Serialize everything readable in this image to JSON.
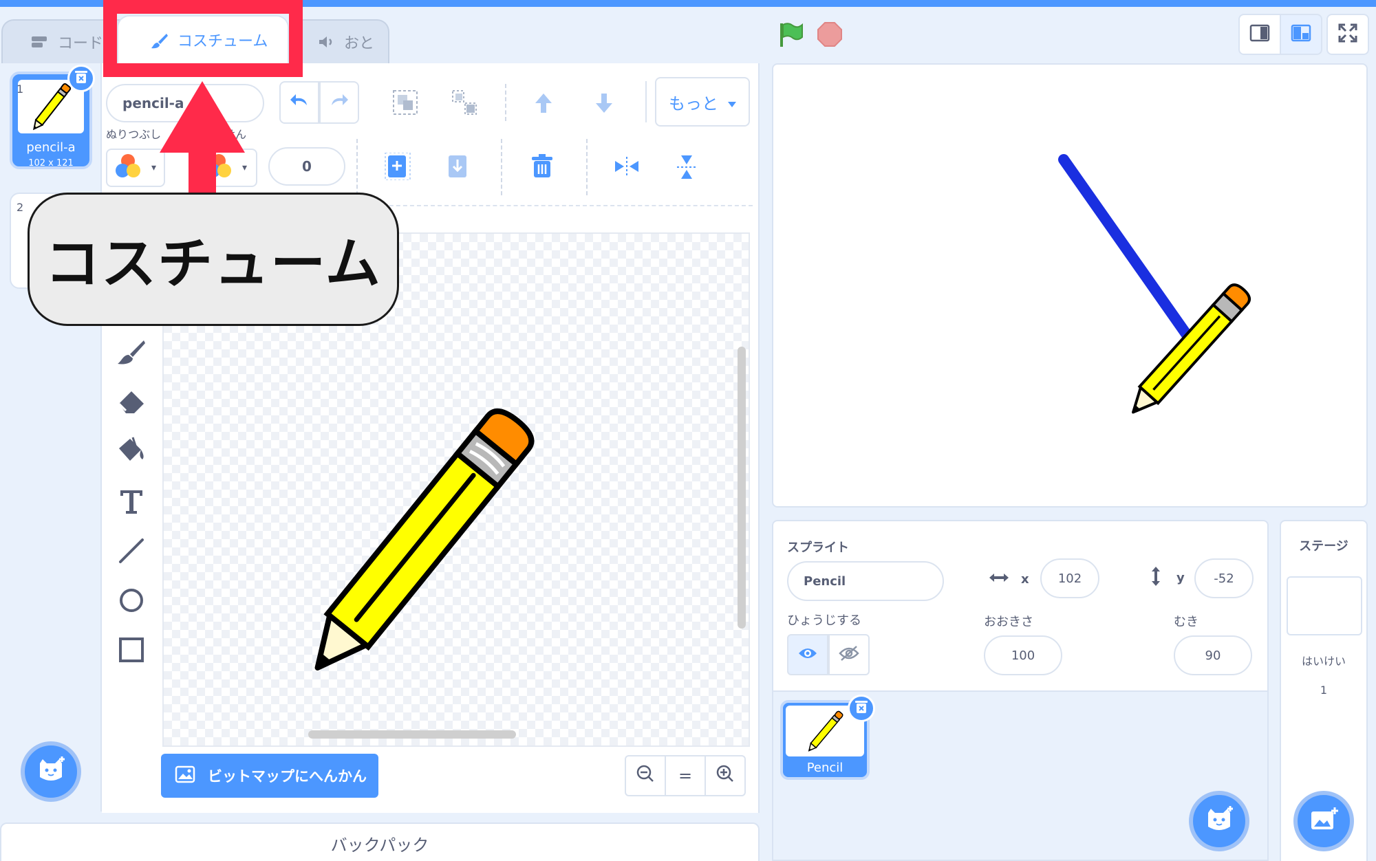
{
  "tabs": {
    "code": "コード",
    "costumes": "コスチューム",
    "sounds": "おと"
  },
  "callout": {
    "text": "コスチューム"
  },
  "costumes": [
    {
      "number": "1",
      "name": "pencil-a",
      "size": "102 x 121"
    },
    {
      "number": "2"
    }
  ],
  "paint": {
    "costume_name": "pencil-a",
    "fill_label": "ぬりつぶし",
    "outline_label": "せん",
    "outline_width": "0",
    "more_label": "もっと",
    "bitmap_button": "ビットマップにへんかん",
    "zoom_reset": "="
  },
  "backpack": "バックパック",
  "sprite": {
    "section_label": "スプライト",
    "name": "Pencil",
    "x_label": "x",
    "x": "102",
    "y_label": "y",
    "y": "-52",
    "show_label": "ひょうじする",
    "size_label": "おおきさ",
    "size": "100",
    "direction_label": "むき",
    "direction": "90",
    "tile_name": "Pencil"
  },
  "stage_panel": {
    "title": "ステージ",
    "backdrops_label": "はいけい",
    "backdrops_count": "1"
  },
  "colors": {
    "accent": "#4c97ff",
    "highlight": "#ff2a4a",
    "pen_line": "#1a2fe0",
    "pencil_body": "#ffff00"
  }
}
